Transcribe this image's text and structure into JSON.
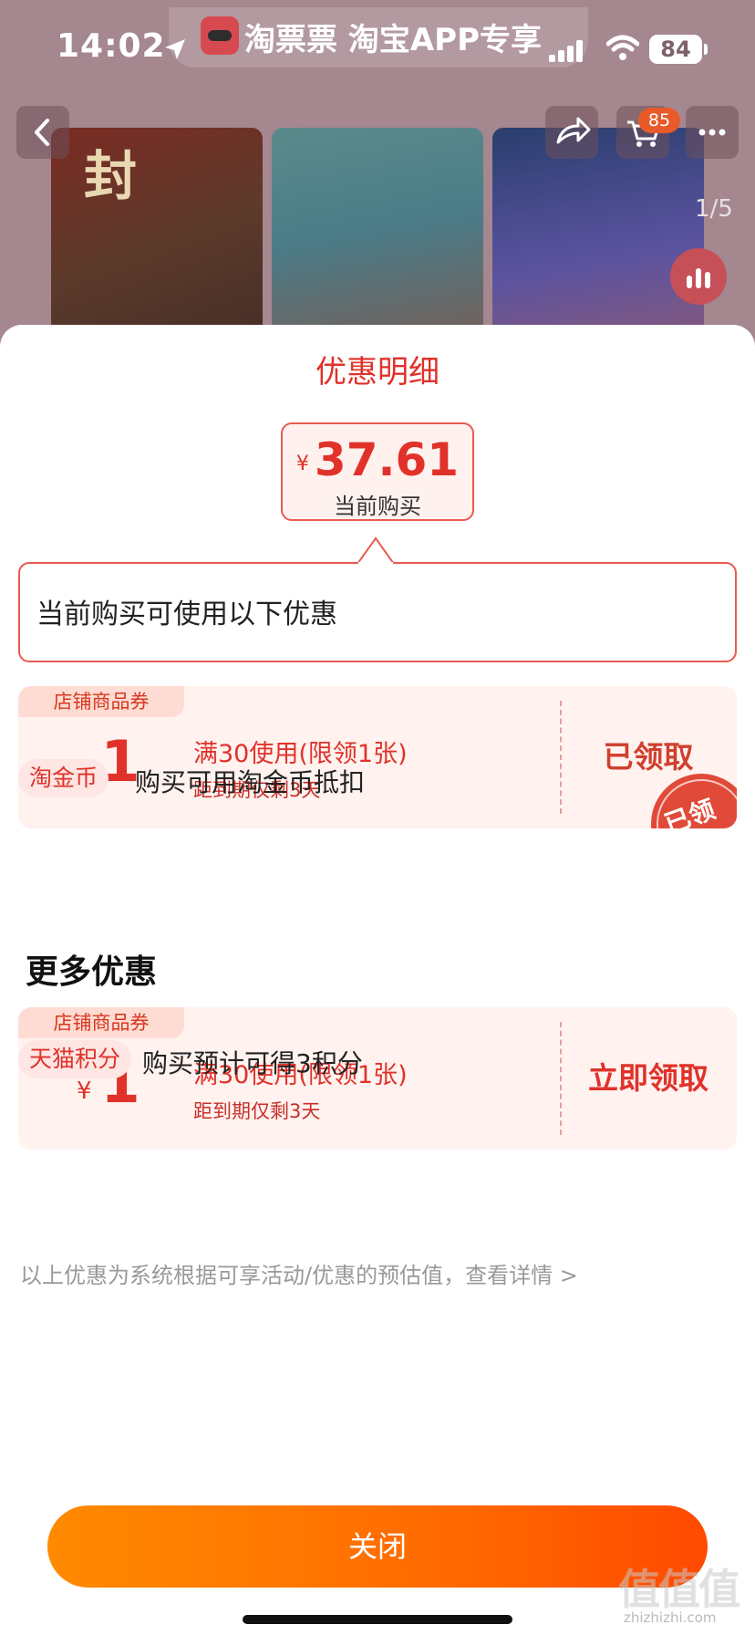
{
  "status_bar": {
    "time": "14:02",
    "battery": "84"
  },
  "banner": {
    "text": "淘票票 淘宝APP专享"
  },
  "top_nav": {
    "cart_badge": "85",
    "gallery_index": "1/5"
  },
  "posters": [
    {
      "title": "封",
      "color": "#7b2b23"
    },
    {
      "title": "",
      "color": "#4b7c88"
    },
    {
      "title": "",
      "color": "#5b53a0"
    }
  ],
  "sheet": {
    "title": "优惠明细",
    "price": {
      "currency": "¥",
      "amount": "37.61",
      "label": "当前购买"
    },
    "info_text": "当前购买可使用以下优惠",
    "coupons_current": [
      {
        "tag": "店铺商品券",
        "currency": "¥",
        "amount": "1",
        "condition": "满30使用(限领1张)",
        "expiry": "距到期仅剩3天",
        "action": "已领取",
        "stamp": "已领"
      }
    ],
    "perk_gold": {
      "tag": "淘金币",
      "text": "购买可用淘金币抵扣"
    },
    "more_title": "更多优惠",
    "coupons_more": [
      {
        "tag": "店铺商品券",
        "currency": "¥",
        "amount": "1",
        "condition": "满30使用(限领1张)",
        "expiry": "距到期仅剩3天",
        "action": "立即领取"
      }
    ],
    "perk_points": {
      "tag": "天猫积分",
      "text": "购买预计可得3积分"
    },
    "disclaimer": "以上优惠为系统根据可享活动/优惠的预估值，查看详情 >",
    "close_label": "关闭"
  },
  "watermark": {
    "text": "值值值",
    "url": "zhizhizhi.com"
  },
  "colors": {
    "accent": "#e0322a",
    "button_start": "#ff8a00",
    "button_end": "#ff4a00"
  }
}
